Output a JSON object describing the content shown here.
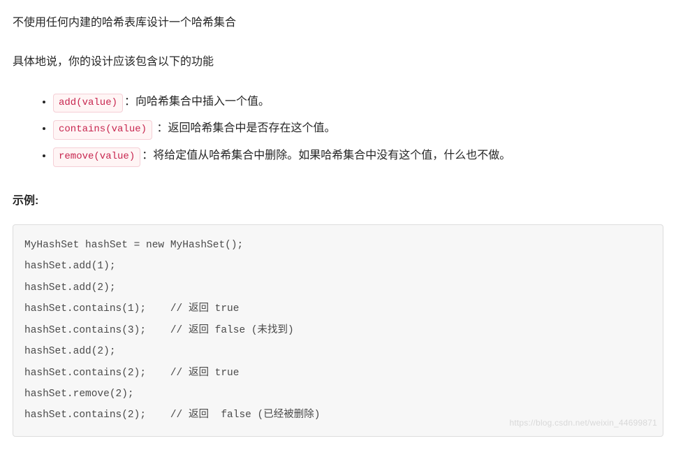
{
  "intro": {
    "line1": "不使用任何内建的哈希表库设计一个哈希集合",
    "line2": "具体地说，你的设计应该包含以下的功能"
  },
  "bullets": [
    {
      "code": "add(value)",
      "desc": "：向哈希集合中插入一个值。"
    },
    {
      "code": "contains(value)",
      "desc": " ：返回哈希集合中是否存在这个值。"
    },
    {
      "code": "remove(value)",
      "desc": "：将给定值从哈希集合中删除。如果哈希集合中没有这个值，什么也不做。"
    }
  ],
  "example_heading": "示例:",
  "code_lines": [
    "MyHashSet hashSet = new MyHashSet();",
    "hashSet.add(1);         ",
    "hashSet.add(2);         ",
    "hashSet.contains(1);    // 返回 true",
    "hashSet.contains(3);    // 返回 false (未找到)",
    "hashSet.add(2);          ",
    "hashSet.contains(2);    // 返回 true",
    "hashSet.remove(2);          ",
    "hashSet.contains(2);    // 返回  false (已经被删除)"
  ],
  "watermark": "https://blog.csdn.net/weixin_44699871"
}
